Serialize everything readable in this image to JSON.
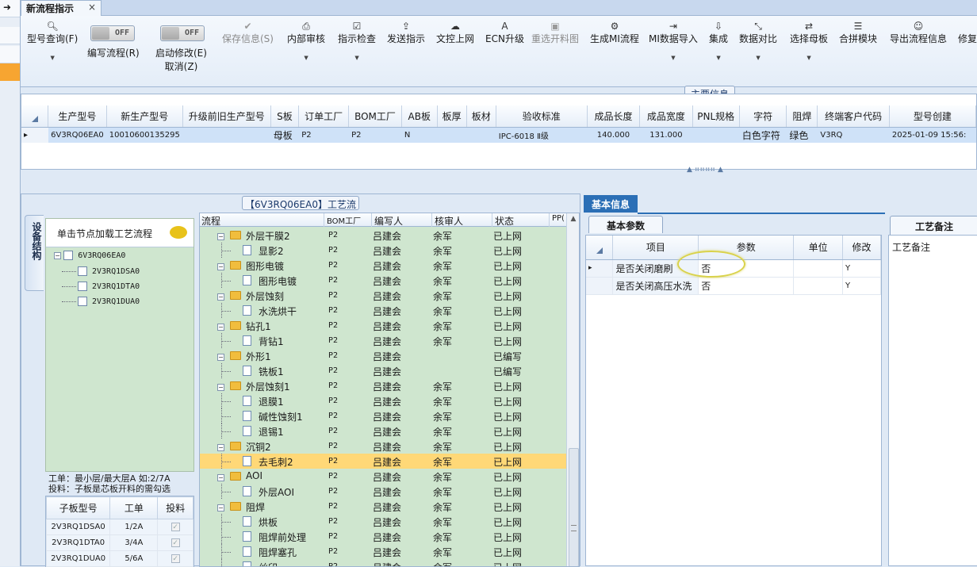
{
  "window": {
    "tab_title": "新流程指示",
    "tab_close": "×"
  },
  "toolbar": {
    "items": [
      {
        "label": "型号查询(F)",
        "icon": "search-icon",
        "enabled": true,
        "dropdown": true
      },
      {
        "label": "编写流程(R)",
        "toggle": "OFF"
      },
      {
        "label": "启动修改(E)",
        "label2": "取消(Z)",
        "toggle": "OFF"
      },
      {
        "label": "保存信息(S)",
        "icon": "save-icon",
        "enabled": false
      },
      {
        "label": "内部审核",
        "icon": "print-icon",
        "enabled": true,
        "dropdown": true
      },
      {
        "label": "指示检查",
        "icon": "check-icon",
        "enabled": true,
        "dropdown": true
      },
      {
        "label": "发送指示",
        "icon": "upload-icon",
        "enabled": true
      },
      {
        "label": "文控上网",
        "icon": "cloud-upload-icon",
        "enabled": true
      },
      {
        "label": "ECN升级",
        "icon": "a-icon",
        "enabled": true
      },
      {
        "label": "重选开料图",
        "icon": "image-icon",
        "enabled": false
      },
      {
        "label": "生成MI流程",
        "icon": "gears-icon",
        "enabled": true
      },
      {
        "label": "MI数据导入",
        "icon": "import-icon",
        "enabled": true,
        "dropdown": true
      },
      {
        "label": "集成",
        "icon": "download-icon",
        "enabled": true,
        "dropdown": true
      },
      {
        "label": "数据对比",
        "icon": "compress-icon",
        "enabled": true,
        "dropdown": true
      },
      {
        "label": "选择母板",
        "icon": "shuffle-icon",
        "enabled": true,
        "dropdown": true
      },
      {
        "label": "合拼模块",
        "icon": "list-icon",
        "enabled": true
      },
      {
        "label": "导出流程信息",
        "icon": "smile-icon",
        "enabled": true
      },
      {
        "label": "修复",
        "icon": "",
        "enabled": true
      }
    ]
  },
  "main_info": {
    "section_title": "主要信息",
    "columns": [
      "生产型号",
      "新生产型号",
      "升级前旧生产型号",
      "S板",
      "订单工厂",
      "BOM工厂",
      "AB板",
      "板厚",
      "板材",
      "验收标准",
      "成品长度",
      "成品宽度",
      "PNL规格",
      "字符",
      "阻焊",
      "终端客户代码",
      "型号创建"
    ],
    "row": [
      "6V3RQ06EA0",
      "10010600135295",
      "",
      "母板",
      "P2",
      "P2",
      "N",
      "",
      "",
      "IPC-6018 Ⅱ级",
      "140.000",
      "131.000",
      "",
      "白色字符",
      "绿色",
      "V3RQ",
      "2025-01-09 15:56:"
    ]
  },
  "structure": {
    "vertical_tab": "设备结构",
    "hint": "单击节点加载工艺流程",
    "root": "6V3RQ06EA0",
    "children": [
      "2V3RQ1DSA0",
      "2V3RQ1DTA0",
      "2V3RQ1DUA0"
    ],
    "info_line1": "工单：最小层/最大层A 如:2/7A",
    "info_line2": "投料：子板是芯板开料的需勾选",
    "sub_columns": [
      "子板型号",
      "工单",
      "投料"
    ],
    "sub_rows": [
      {
        "model": "2V3RQ1DSA0",
        "order": "1/2A",
        "feed": "✓"
      },
      {
        "model": "2V3RQ1DTA0",
        "order": "3/4A",
        "feed": "✓"
      },
      {
        "model": "2V3RQ1DUA0",
        "order": "5/6A",
        "feed": "✓"
      }
    ]
  },
  "flow": {
    "title": "【6V3RQ06EA0】工艺流程",
    "columns": [
      "流程",
      "BOM工厂",
      "编写人",
      "核审人",
      "状态",
      "PP("
    ],
    "rows": [
      {
        "type": "folder",
        "name": "外层干膜2",
        "bom": "P2",
        "writer": "吕建会",
        "reviewer": "余军",
        "status": "已上网"
      },
      {
        "type": "doc",
        "name": "显影2",
        "bom": "P2",
        "writer": "吕建会",
        "reviewer": "余军",
        "status": "已上网"
      },
      {
        "type": "folder",
        "name": "图形电镀",
        "bom": "P2",
        "writer": "吕建会",
        "reviewer": "余军",
        "status": "已上网"
      },
      {
        "type": "doc",
        "name": "图形电镀",
        "bom": "P2",
        "writer": "吕建会",
        "reviewer": "余军",
        "status": "已上网"
      },
      {
        "type": "folder",
        "name": "外层蚀刻",
        "bom": "P2",
        "writer": "吕建会",
        "reviewer": "余军",
        "status": "已上网"
      },
      {
        "type": "doc",
        "name": "水洗烘干",
        "bom": "P2",
        "writer": "吕建会",
        "reviewer": "余军",
        "status": "已上网"
      },
      {
        "type": "folder",
        "name": "钻孔1",
        "bom": "P2",
        "writer": "吕建会",
        "reviewer": "余军",
        "status": "已上网"
      },
      {
        "type": "doc",
        "name": "背钻1",
        "bom": "P2",
        "writer": "吕建会",
        "reviewer": "余军",
        "status": "已上网"
      },
      {
        "type": "folder",
        "name": "外形1",
        "bom": "P2",
        "writer": "吕建会",
        "reviewer": "",
        "status": "已编写"
      },
      {
        "type": "doc",
        "name": "铣板1",
        "bom": "P2",
        "writer": "吕建会",
        "reviewer": "",
        "status": "已编写"
      },
      {
        "type": "folder",
        "name": "外层蚀刻1",
        "bom": "P2",
        "writer": "吕建会",
        "reviewer": "余军",
        "status": "已上网"
      },
      {
        "type": "doc",
        "name": "退膜1",
        "bom": "P2",
        "writer": "吕建会",
        "reviewer": "余军",
        "status": "已上网"
      },
      {
        "type": "doc",
        "name": "碱性蚀刻1",
        "bom": "P2",
        "writer": "吕建会",
        "reviewer": "余军",
        "status": "已上网"
      },
      {
        "type": "doc",
        "name": "退锡1",
        "bom": "P2",
        "writer": "吕建会",
        "reviewer": "余军",
        "status": "已上网"
      },
      {
        "type": "folder",
        "name": "沉铜2",
        "bom": "P2",
        "writer": "吕建会",
        "reviewer": "余军",
        "status": "已上网"
      },
      {
        "type": "doc",
        "name": "去毛刺2",
        "bom": "P2",
        "writer": "吕建会",
        "reviewer": "余军",
        "status": "已上网",
        "selected": true
      },
      {
        "type": "folder",
        "name": "AOI",
        "bom": "P2",
        "writer": "吕建会",
        "reviewer": "余军",
        "status": "已上网"
      },
      {
        "type": "doc",
        "name": "外层AOI",
        "bom": "P2",
        "writer": "吕建会",
        "reviewer": "余军",
        "status": "已上网"
      },
      {
        "type": "folder",
        "name": "阻焊",
        "bom": "P2",
        "writer": "吕建会",
        "reviewer": "余军",
        "status": "已上网"
      },
      {
        "type": "doc",
        "name": "烘板",
        "bom": "P2",
        "writer": "吕建会",
        "reviewer": "余军",
        "status": "已上网"
      },
      {
        "type": "doc",
        "name": "阻焊前处理",
        "bom": "P2",
        "writer": "吕建会",
        "reviewer": "余军",
        "status": "已上网"
      },
      {
        "type": "doc",
        "name": "阻焊塞孔",
        "bom": "P2",
        "writer": "吕建会",
        "reviewer": "余军",
        "status": "已上网"
      },
      {
        "type": "doc",
        "name": "丝印",
        "bom": "P2",
        "writer": "吕建会",
        "reviewer": "余军",
        "status": "已上网"
      }
    ]
  },
  "basic": {
    "tab": "基本信息",
    "params_tab": "基本参数",
    "columns": [
      "项目",
      "参数",
      "单位",
      "修改"
    ],
    "rows": [
      {
        "item": "是否关闭磨刷",
        "value": "否",
        "unit": "",
        "modify": "Y"
      },
      {
        "item": "是否关闭高压水洗",
        "value": "否",
        "unit": "",
        "modify": "Y"
      }
    ]
  },
  "notes": {
    "tab": "工艺备注",
    "label": "工艺备注"
  },
  "colors": {
    "accent": "#2b6fb6",
    "tree_bg": "#cfe6cf",
    "selected_row": "#ffd877"
  }
}
